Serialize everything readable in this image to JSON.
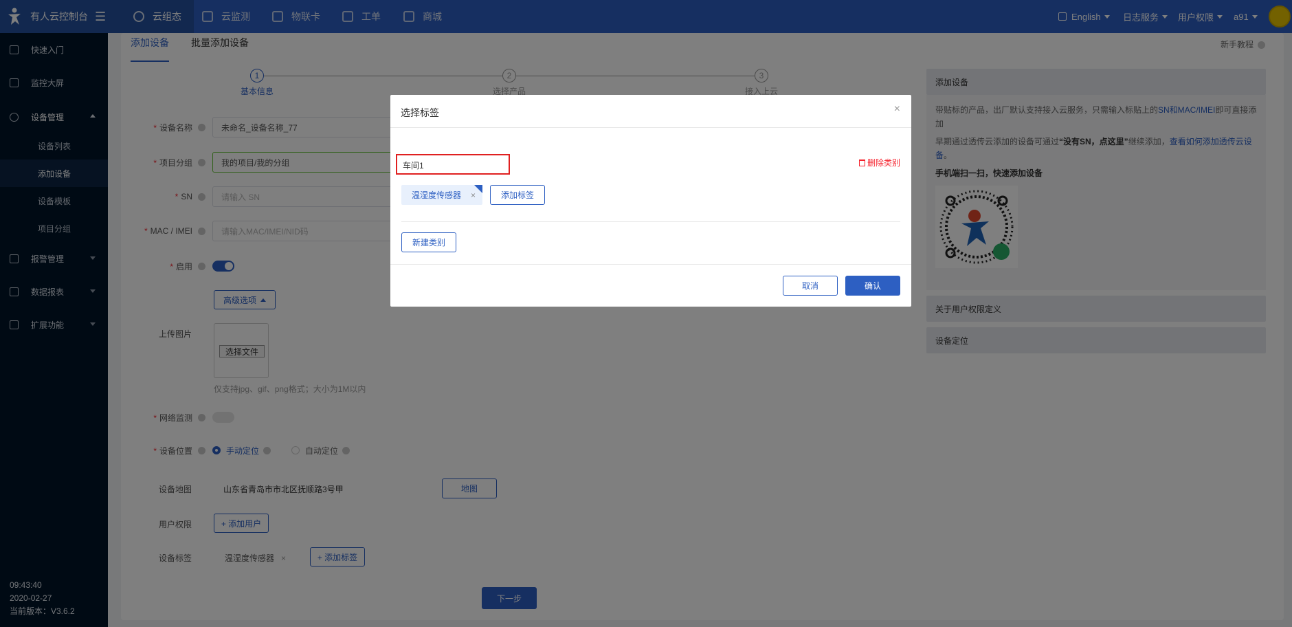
{
  "app": {
    "title": "有人云控制台"
  },
  "topnav": {
    "tabs": [
      {
        "label": "云组态",
        "icon": "cloud-icon"
      },
      {
        "label": "云监测",
        "icon": "monitor-icon"
      },
      {
        "label": "物联卡",
        "icon": "sim-card-icon"
      },
      {
        "label": "工单",
        "icon": "ticket-icon"
      },
      {
        "label": "商城",
        "icon": "store-icon"
      }
    ],
    "language": "English",
    "log_service": "日志服务",
    "user_permission": "用户权限",
    "user": "a91"
  },
  "sidebar": {
    "items": [
      {
        "label": "快速入门"
      },
      {
        "label": "监控大屏"
      },
      {
        "label": "设备管理"
      },
      {
        "label": "报警管理"
      },
      {
        "label": "数据报表"
      },
      {
        "label": "扩展功能"
      }
    ],
    "sub_items": [
      {
        "label": "设备列表"
      },
      {
        "label": "添加设备"
      },
      {
        "label": "设备模板"
      },
      {
        "label": "项目分组"
      }
    ],
    "time": "09:43:40",
    "date": "2020-02-27",
    "version": "当前版本：V3.6.2"
  },
  "page": {
    "tabs": [
      "添加设备",
      "批量添加设备"
    ],
    "tutorial": "新手教程",
    "steps": [
      {
        "num": "1",
        "label": "基本信息"
      },
      {
        "num": "2",
        "label": "选择产品"
      },
      {
        "num": "3",
        "label": "接入上云"
      }
    ]
  },
  "form": {
    "device_name_label": "设备名称",
    "device_name_value": "未命名_设备名称_77",
    "group_label": "项目分组",
    "group_value": "我的项目/我的分组",
    "sn_label": "SN",
    "sn_placeholder": "请输入 SN",
    "mac_label": "MAC / IMEI",
    "mac_placeholder": "请输入MAC/IMEI/NID码",
    "enable_label": "启用",
    "advanced_btn": "高级选项",
    "upload_label": "上传图片",
    "choose_file": "选择文件",
    "upload_hint": "仅支持jpg、gif、png格式；大小为1M以内",
    "network_label": "网络监测",
    "location_label": "设备位置",
    "manual_loc": "手动定位",
    "auto_loc": "自动定位",
    "map_label": "设备地图",
    "map_address": "山东省青岛市市北区抚顺路3号甲",
    "map_btn": "地图",
    "perm_label": "用户权限",
    "add_user_btn": "+ 添加用户",
    "tag_label": "设备标签",
    "tag_value": "温湿度传感器",
    "add_tag_btn": "+ 添加标签",
    "next_btn": "下一步"
  },
  "help_panel": {
    "title": "添加设备",
    "text1_a": "带贴标的产品，出厂默认支持接入云服务，只需输入标贴上的",
    "text1_link": "SN和MAC/IMEI",
    "text1_b": "即可直接添加",
    "text2_a": "早期通过透传云添加的设备可通过",
    "text2_bold": "“没有SN，点这里”",
    "text2_b": "继续添加，",
    "text2_link": "查看如何添加透传云设备",
    "text2_end": "。",
    "scan_title": "手机端扫一扫，快速添加设备",
    "section2": "关于用户权限定义",
    "section3": "设备定位"
  },
  "modal": {
    "title": "选择标签",
    "category_value": "车间1",
    "delete_category": "删除类别",
    "tag": "温湿度传感器",
    "add_tag": "添加标签",
    "new_category": "新建类别",
    "cancel": "取消",
    "confirm": "确认"
  },
  "colors": {
    "primary": "#2d5fc2",
    "sidebar": "#001529",
    "danger": "#f5222d"
  }
}
